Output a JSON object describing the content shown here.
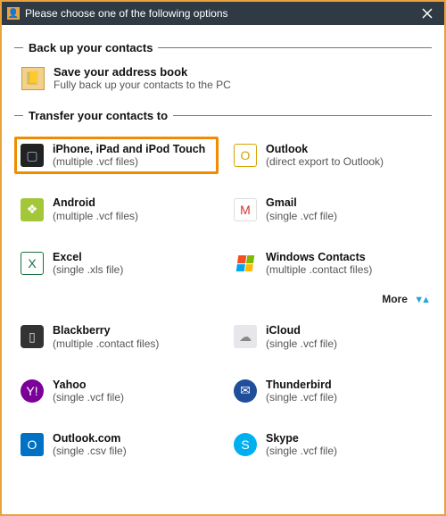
{
  "titlebar": {
    "title": "Please choose one of the following options"
  },
  "backup": {
    "header": "Back up your contacts",
    "item": {
      "title": "Save your address book",
      "subtitle": "Fully back up your contacts to the PC"
    }
  },
  "transfer": {
    "header": "Transfer your contacts to",
    "more_label": "More",
    "options": [
      {
        "id": "iphone",
        "title": "iPhone, iPad and iPod Touch",
        "subtitle": "(multiple .vcf files)",
        "highlight": true
      },
      {
        "id": "outlook",
        "title": "Outlook",
        "subtitle": "(direct export to Outlook)",
        "highlight": false
      },
      {
        "id": "android",
        "title": "Android",
        "subtitle": "(multiple .vcf files)",
        "highlight": false
      },
      {
        "id": "gmail",
        "title": "Gmail",
        "subtitle": "(single .vcf file)",
        "highlight": false
      },
      {
        "id": "excel",
        "title": "Excel",
        "subtitle": "(single .xls file)",
        "highlight": false
      },
      {
        "id": "wincontacts",
        "title": "Windows Contacts",
        "subtitle": "(multiple .contact files)",
        "highlight": false
      },
      {
        "id": "blackberry",
        "title": "Blackberry",
        "subtitle": "(multiple .contact files)",
        "highlight": false
      },
      {
        "id": "icloud",
        "title": "iCloud",
        "subtitle": "(single .vcf file)",
        "highlight": false
      },
      {
        "id": "yahoo",
        "title": "Yahoo",
        "subtitle": "(single .vcf file)",
        "highlight": false
      },
      {
        "id": "thunderbird",
        "title": "Thunderbird",
        "subtitle": "(single .vcf file)",
        "highlight": false
      },
      {
        "id": "outlookcom",
        "title": "Outlook.com",
        "subtitle": "(single .csv file)",
        "highlight": false
      },
      {
        "id": "skype",
        "title": "Skype",
        "subtitle": "(single .vcf file)",
        "highlight": false
      }
    ]
  },
  "icons": {
    "iphone": "▢",
    "outlook": "O",
    "android": "❖",
    "gmail": "M",
    "excel": "X",
    "wincontacts": "",
    "blackberry": "▯",
    "icloud": "☁",
    "yahoo": "Y!",
    "thunderbird": "✉",
    "outlookcom": "O",
    "skype": "S"
  }
}
